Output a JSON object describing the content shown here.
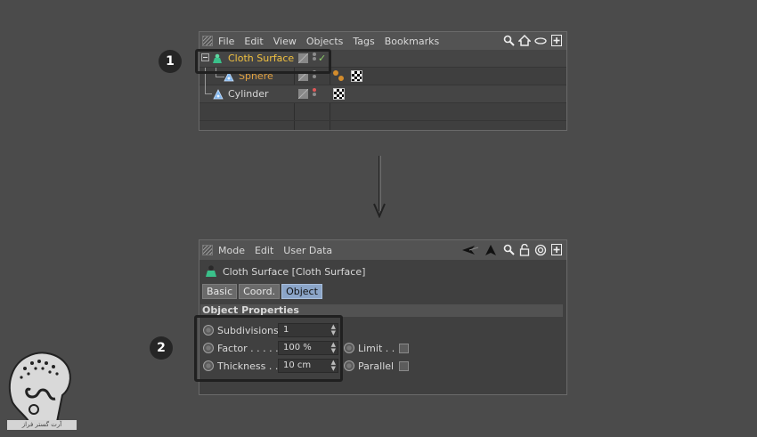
{
  "object_manager": {
    "menu": [
      "File",
      "Edit",
      "View",
      "Objects",
      "Tags",
      "Bookmarks"
    ],
    "tools": [
      "search-icon",
      "home-icon",
      "eye-icon",
      "new-window-icon"
    ],
    "objects": [
      {
        "name": "Cloth Surface",
        "color": "#f0c040",
        "icon": "cloth-surface-icon",
        "selected": true
      },
      {
        "name": "Sphere",
        "color": "#e0a040",
        "icon": "sphere-icon"
      },
      {
        "name": "Cylinder",
        "color": "#d8d8d8",
        "icon": "cylinder-icon"
      }
    ]
  },
  "attribute_manager": {
    "menu": [
      "Mode",
      "Edit",
      "User Data"
    ],
    "tools": [
      "back-arrow-icon",
      "forward-arrow-icon",
      "search-icon",
      "lock-icon",
      "target-icon",
      "new-window-icon"
    ],
    "title": "Cloth Surface [Cloth Surface]",
    "tabs": [
      "Basic",
      "Coord.",
      "Object"
    ],
    "active_tab": "Object",
    "section": "Object Properties",
    "properties": [
      {
        "label": "Subdivisions",
        "value": "1"
      },
      {
        "label": "Factor . . . . . .",
        "value": "100 %"
      },
      {
        "label": "Thickness . . .",
        "value": "10 cm"
      }
    ],
    "side_options": [
      {
        "label": "Limit . ."
      },
      {
        "label": "Parallel"
      }
    ]
  },
  "badges": [
    "1",
    "2"
  ],
  "watermark": "آرت گستر فراز",
  "colors": {
    "background": "#4b4b4b",
    "accent_tab": "#8ba5c8",
    "badge": "#262626"
  }
}
